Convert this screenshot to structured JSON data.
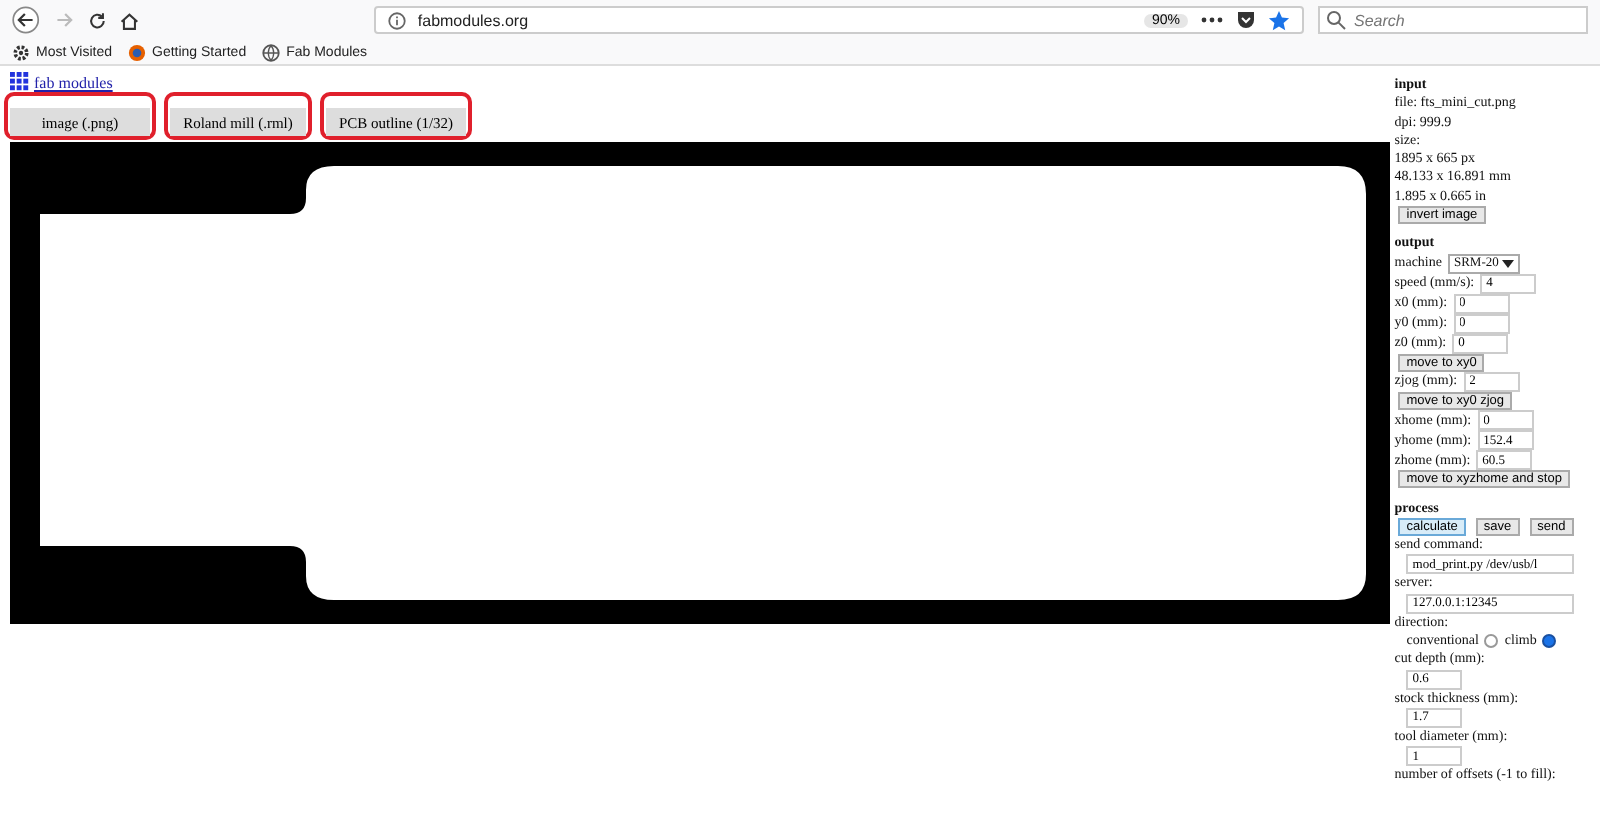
{
  "browser": {
    "url": "fabmodules.org",
    "zoom": "90%",
    "search": {
      "placeholder": "Search"
    },
    "back_disabled": false,
    "forward_disabled": true,
    "bookmarks": [
      {
        "label": "Most Visited"
      },
      {
        "label": "Getting Started"
      },
      {
        "label": "Fab Modules"
      }
    ]
  },
  "page": {
    "title_link": "fab modules",
    "tabs": [
      {
        "label": "image (.png)",
        "highlighted": true
      },
      {
        "label": "Roland mill (.rml)",
        "highlighted": true
      },
      {
        "label": "PCB outline (1/32)",
        "highlighted": true
      }
    ],
    "panel": [
      {
        "heading": "input",
        "rows": [
          {
            "kind": "text",
            "text": "file: fts_mini_cut.png"
          },
          {
            "kind": "text",
            "text": "dpi: 999.9"
          },
          {
            "kind": "text",
            "text": "size:"
          },
          {
            "kind": "text",
            "text": "1895 x 665 px"
          },
          {
            "kind": "text",
            "text": "48.133 x 16.891 mm"
          },
          {
            "kind": "text",
            "text": "1.895 x 0.665 in"
          },
          {
            "kind": "buttons",
            "buttons": [
              {
                "label": "invert image",
                "primary": false
              }
            ]
          }
        ]
      },
      {
        "heading": "output",
        "rows": [
          {
            "kind": "select",
            "label": "machine",
            "value": "SRM-20"
          },
          {
            "kind": "field",
            "label": "speed (mm/s):",
            "value": "4"
          },
          {
            "kind": "field",
            "label": "x0 (mm):",
            "value": "0"
          },
          {
            "kind": "field",
            "label": "y0 (mm):",
            "value": "0"
          },
          {
            "kind": "field",
            "label": "z0 (mm):",
            "value": "0"
          },
          {
            "kind": "buttons",
            "buttons": [
              {
                "label": "move to xy0",
                "primary": false
              }
            ]
          },
          {
            "kind": "field",
            "label": "zjog (mm):",
            "value": "2"
          },
          {
            "kind": "buttons",
            "buttons": [
              {
                "label": "move to xy0 zjog",
                "primary": false
              }
            ]
          },
          {
            "kind": "field",
            "label": "xhome (mm):",
            "value": "0"
          },
          {
            "kind": "field",
            "label": "yhome (mm):",
            "value": "152.4"
          },
          {
            "kind": "field",
            "label": "zhome (mm):",
            "value": "60.5"
          },
          {
            "kind": "buttons",
            "buttons": [
              {
                "label": "move to xyzhome and stop",
                "primary": false
              }
            ]
          }
        ]
      },
      {
        "heading": "process",
        "rows": [
          {
            "kind": "buttons",
            "buttons": [
              {
                "label": "calculate",
                "primary": true
              },
              {
                "label": "save",
                "primary": false
              },
              {
                "label": "send",
                "primary": false
              }
            ]
          },
          {
            "kind": "text",
            "text": "send command:"
          },
          {
            "kind": "wide_field",
            "value": "mod_print.py /dev/usb/l"
          },
          {
            "kind": "text",
            "text": "server:"
          },
          {
            "kind": "wide_field",
            "value": "127.0.0.1:12345"
          },
          {
            "kind": "text",
            "text": "direction:"
          },
          {
            "kind": "radio",
            "options": [
              {
                "label": "conventional",
                "selected": false
              },
              {
                "label": "climb",
                "selected": true
              }
            ]
          },
          {
            "kind": "text",
            "text": "cut depth (mm):"
          },
          {
            "kind": "short_field",
            "value": "0.6"
          },
          {
            "kind": "text",
            "text": "stock thickness (mm):"
          },
          {
            "kind": "short_field",
            "value": "1.7"
          },
          {
            "kind": "text",
            "text": "tool diameter (mm):"
          },
          {
            "kind": "short_field",
            "value": "1"
          },
          {
            "kind": "text",
            "text": "number of offsets (-1 to fill):"
          }
        ]
      }
    ]
  }
}
